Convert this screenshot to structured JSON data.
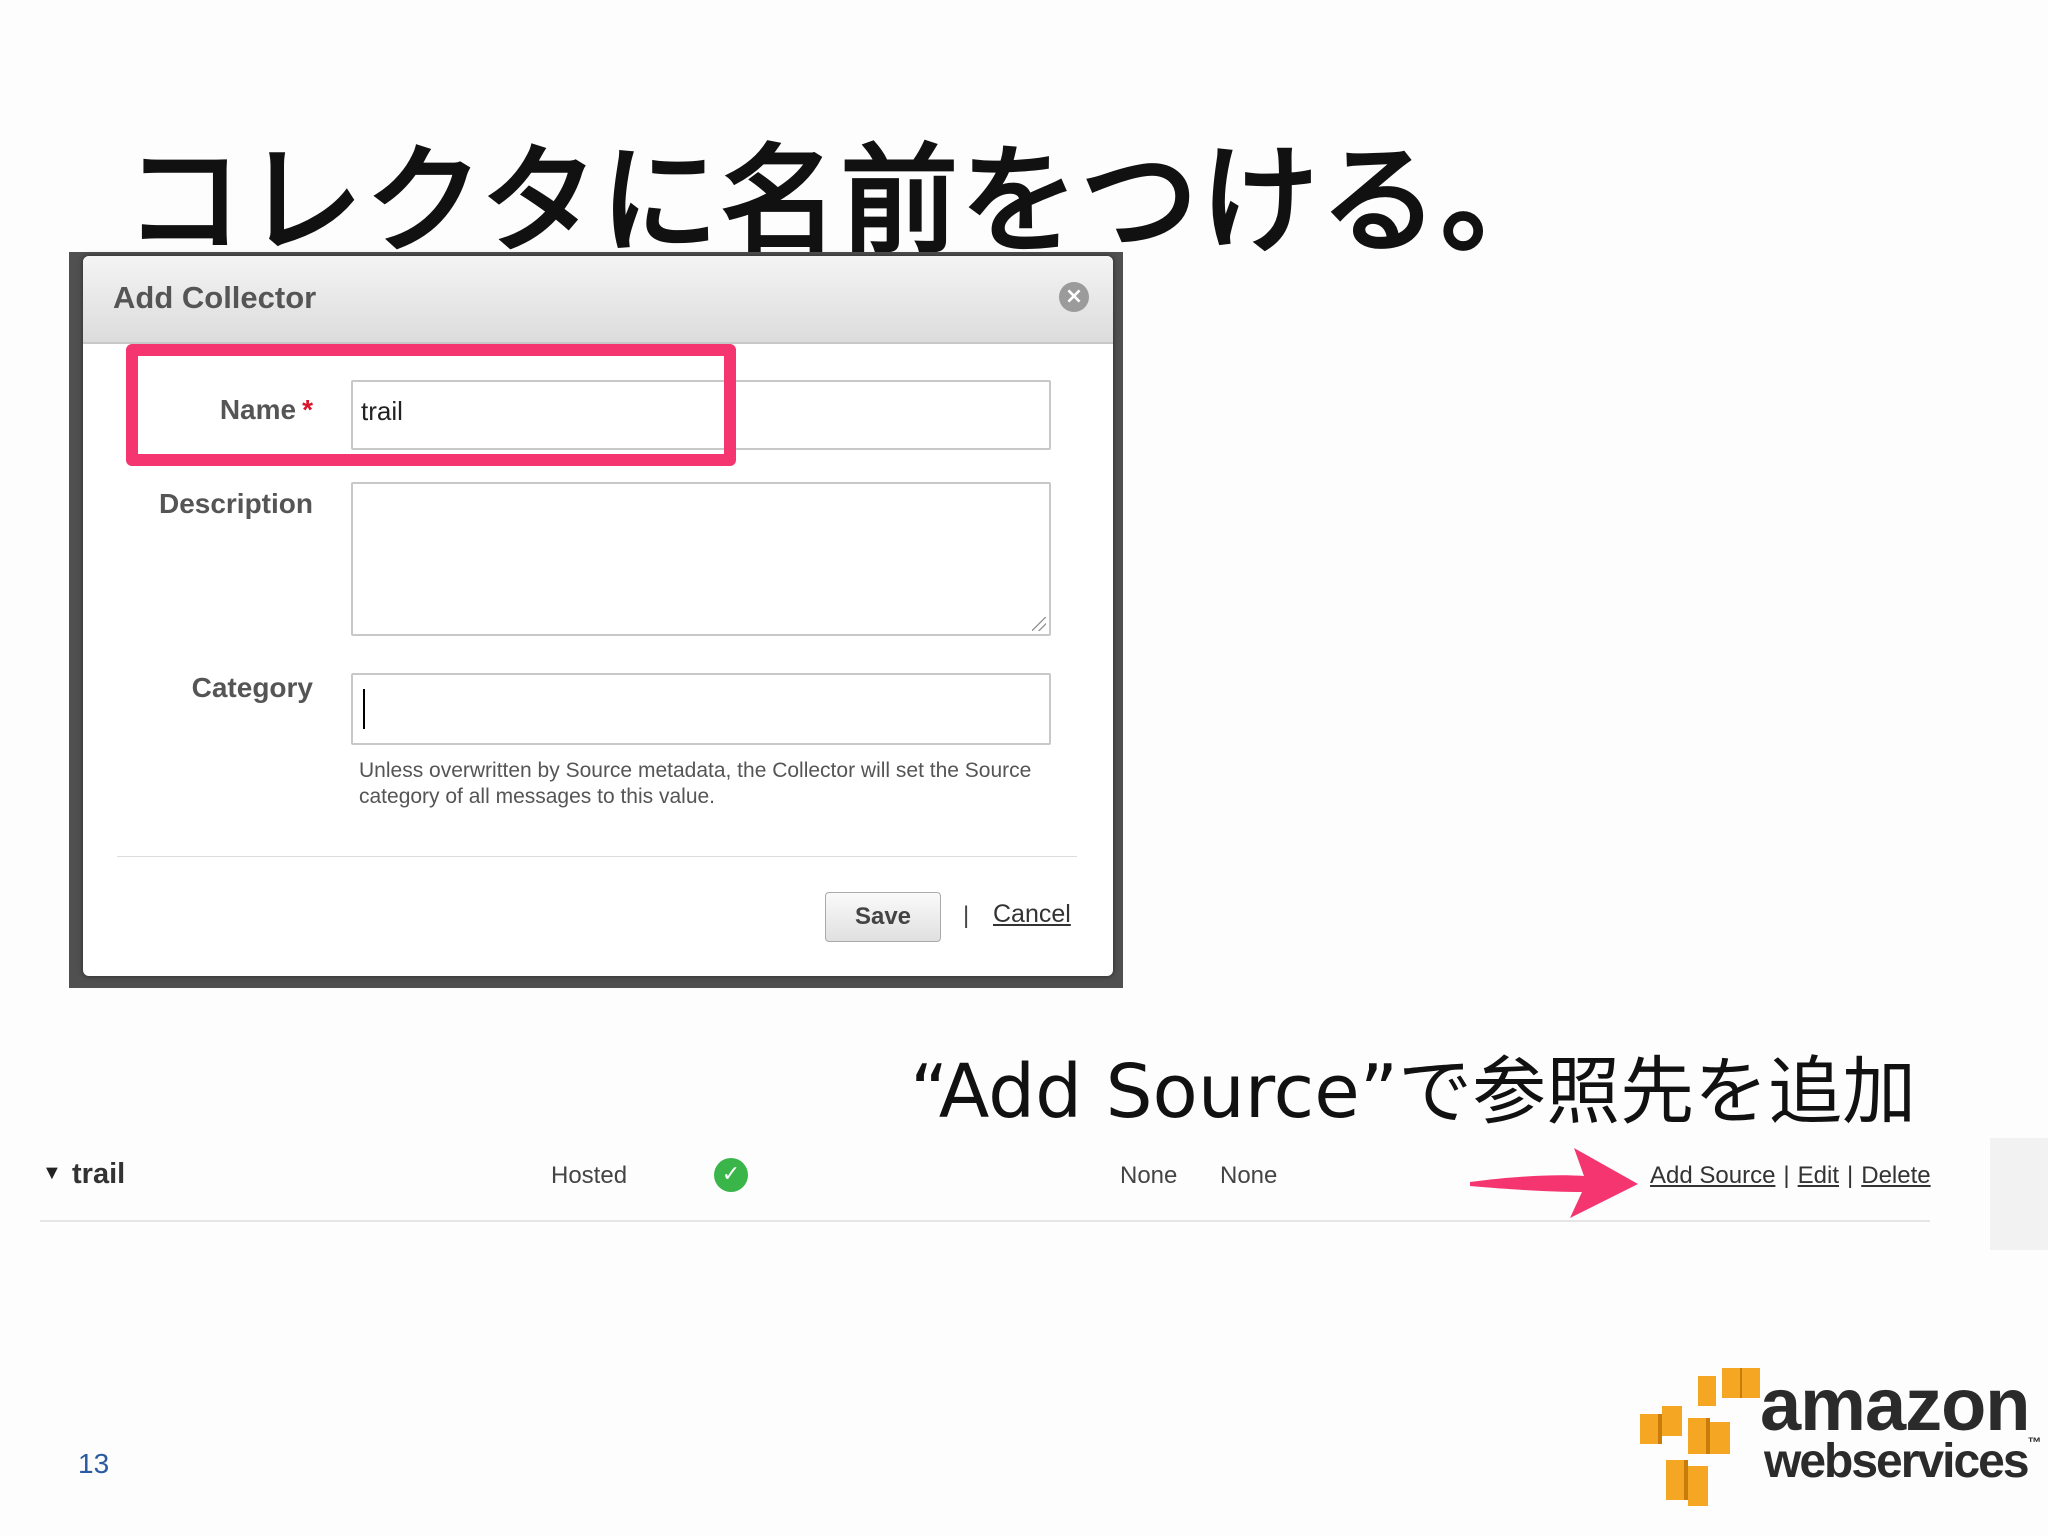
{
  "slide": {
    "title": "コレクタに名前をつける。",
    "caption": "“Add Source”で参照先を追加",
    "page_number": "13"
  },
  "dialog": {
    "title": "Add Collector",
    "close_icon": "close-icon",
    "name_label": "Name",
    "required_marker": "*",
    "name_value": "trail",
    "description_label": "Description",
    "description_value": "",
    "category_label": "Category",
    "category_value": "",
    "help_text": "Unless overwritten by Source metadata, the Collector will set the Source category of all messages to this value.",
    "save_label": "Save",
    "separator": "|",
    "cancel_label": "Cancel",
    "highlight_color": "#f4356f"
  },
  "collector_row": {
    "toggle_icon": "triangle-down-icon",
    "name": "trail",
    "type": "Hosted",
    "status_icon": "check-circle-icon",
    "status_color": "#3ab54a",
    "col1": "None",
    "col2": "None",
    "actions": {
      "add_source": "Add Source",
      "edit": "Edit",
      "delete": "Delete",
      "separator": "|"
    },
    "arrow_color": "#f4356f"
  },
  "logo": {
    "line1": "amazon",
    "line2": "webservices",
    "trademark": "™",
    "box_color": "#f5a623"
  }
}
